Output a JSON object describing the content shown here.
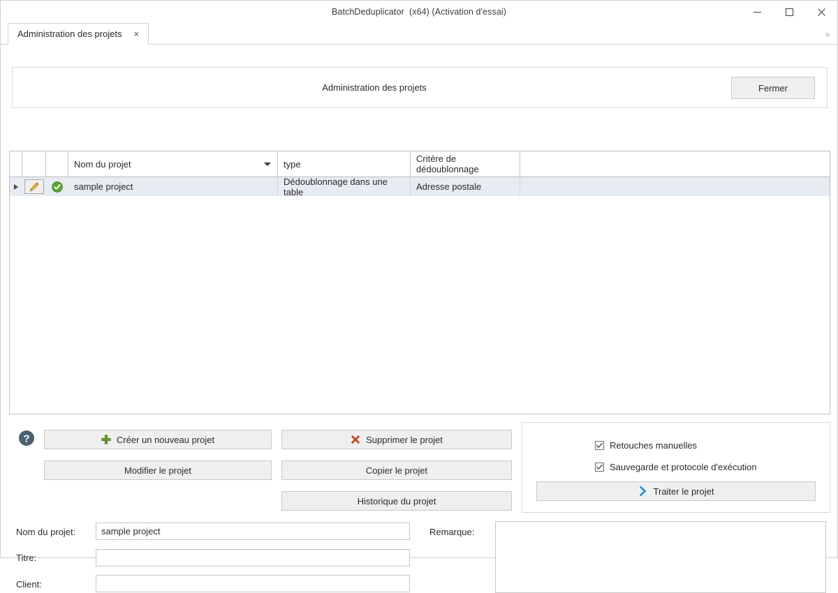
{
  "window": {
    "title": "BatchDeduplicator  (x64) (Activation d'essai)",
    "minimize_label": "Minimiser",
    "maximize_label": "Agrandir",
    "close_label": "Fermer"
  },
  "tabs": [
    {
      "label": "Administration des projets",
      "close_label": "×"
    }
  ],
  "tabstrip": {
    "close_all_label": "×"
  },
  "header": {
    "title": "Administration des projets",
    "close_button": "Fermer"
  },
  "grid": {
    "columns": [
      {
        "key": "selector",
        "label": ""
      },
      {
        "key": "edit",
        "label": ""
      },
      {
        "key": "state",
        "label": ""
      },
      {
        "key": "name",
        "label": "Nom du projet",
        "sorted": "desc"
      },
      {
        "key": "type",
        "label": "type"
      },
      {
        "key": "criteria",
        "label": "Critère de dédoublonnage"
      },
      {
        "key": "filler",
        "label": ""
      }
    ],
    "rows": [
      {
        "selected": true,
        "edit_icon": "pencil-icon",
        "state_icon": "check-circle-icon",
        "name": "sample project",
        "type": "Dédoublonnage dans une table",
        "criteria": "Adresse postale"
      }
    ]
  },
  "actions": {
    "help_label": "?",
    "new_project": "Créer un nouveau projet",
    "modify_project": "Modifier le projet",
    "delete_project": "Supprimer le projet",
    "copy_project": "Copier le projet",
    "project_history": "Historique du projet"
  },
  "options": {
    "manual_touchup": {
      "label": "Retouches manuelles",
      "checked": true
    },
    "backup_protocol": {
      "label": "Sauvegarde et protocole d'exécution",
      "checked": true
    },
    "process_project": "Traiter le projet"
  },
  "form": {
    "project_name_label": "Nom du projet:",
    "project_name_value": "sample project",
    "title_label": "Titre:",
    "title_value": "",
    "client_label": "Client:",
    "client_value": "",
    "remark_label": "Remarque:",
    "remark_value": ""
  },
  "colors": {
    "accent_blue": "#1e90d8",
    "success_green": "#4ca32e",
    "danger_red": "#d9481f",
    "add_green": "#6a9c2e",
    "pencil_orange": "#f0b428",
    "selection_bg": "#e7ecf2",
    "help_slate": "#4a6170"
  }
}
